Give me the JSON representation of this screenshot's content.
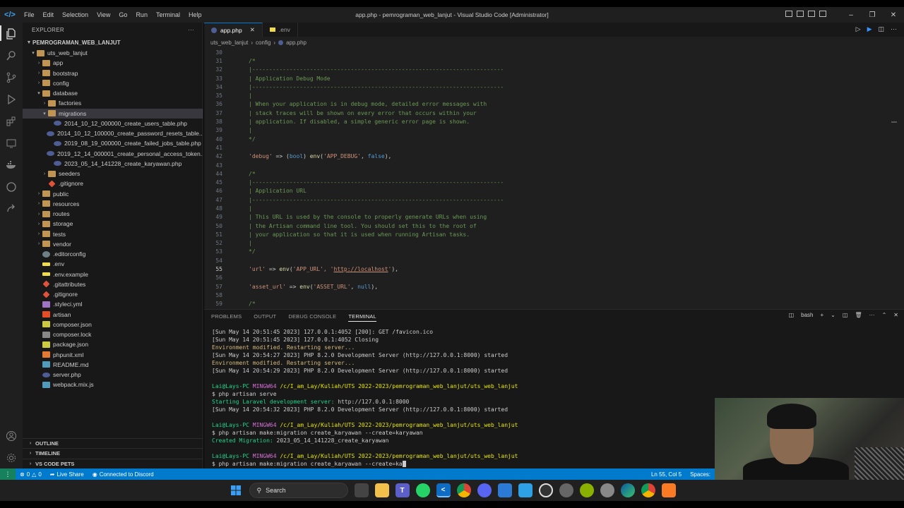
{
  "window": {
    "title": "app.php - pemrograman_web_lanjut - Visual Studio Code [Administrator]",
    "menu": [
      "File",
      "Edit",
      "Selection",
      "View",
      "Go",
      "Run",
      "Terminal",
      "Help"
    ]
  },
  "sidebar": {
    "header": "EXPLORER",
    "root": "PEMROGRAMAN_WEB_LANJUT",
    "tree": [
      {
        "label": "uts_web_lanjut",
        "indent": 0,
        "type": "folder",
        "open": true
      },
      {
        "label": "app",
        "indent": 1,
        "type": "folder"
      },
      {
        "label": "bootstrap",
        "indent": 1,
        "type": "folder"
      },
      {
        "label": "config",
        "indent": 1,
        "type": "folder"
      },
      {
        "label": "database",
        "indent": 1,
        "type": "folder",
        "open": true
      },
      {
        "label": "factories",
        "indent": 2,
        "type": "folder"
      },
      {
        "label": "migrations",
        "indent": 2,
        "type": "folder",
        "open": true,
        "selected": true
      },
      {
        "label": "2014_10_12_000000_create_users_table.php",
        "indent": 3,
        "type": "php"
      },
      {
        "label": "2014_10_12_100000_create_password_resets_table....",
        "indent": 3,
        "type": "php"
      },
      {
        "label": "2019_08_19_000000_create_failed_jobs_table.php",
        "indent": 3,
        "type": "php"
      },
      {
        "label": "2019_12_14_000001_create_personal_access_token...",
        "indent": 3,
        "type": "php"
      },
      {
        "label": "2023_05_14_141228_create_karyawan.php",
        "indent": 3,
        "type": "php"
      },
      {
        "label": "seeders",
        "indent": 2,
        "type": "folder"
      },
      {
        "label": ".gitignore",
        "indent": 2,
        "type": "git"
      },
      {
        "label": "public",
        "indent": 1,
        "type": "folder"
      },
      {
        "label": "resources",
        "indent": 1,
        "type": "folder"
      },
      {
        "label": "routes",
        "indent": 1,
        "type": "folder"
      },
      {
        "label": "storage",
        "indent": 1,
        "type": "folder"
      },
      {
        "label": "tests",
        "indent": 1,
        "type": "folder"
      },
      {
        "label": "vendor",
        "indent": 1,
        "type": "folder"
      },
      {
        "label": ".editorconfig",
        "indent": 1,
        "type": "gear"
      },
      {
        "label": ".env",
        "indent": 1,
        "type": "env"
      },
      {
        "label": ".env.example",
        "indent": 1,
        "type": "env"
      },
      {
        "label": ".gitattributes",
        "indent": 1,
        "type": "git"
      },
      {
        "label": ".gitignore",
        "indent": 1,
        "type": "git"
      },
      {
        "label": ".styleci.yml",
        "indent": 1,
        "type": "yml"
      },
      {
        "label": "artisan",
        "indent": 1,
        "type": "red"
      },
      {
        "label": "composer.json",
        "indent": 1,
        "type": "json"
      },
      {
        "label": "composer.lock",
        "indent": 1,
        "type": "txt"
      },
      {
        "label": "package.json",
        "indent": 1,
        "type": "json"
      },
      {
        "label": "phpunit.xml",
        "indent": 1,
        "type": "xml"
      },
      {
        "label": "README.md",
        "indent": 1,
        "type": "md"
      },
      {
        "label": "server.php",
        "indent": 1,
        "type": "php"
      },
      {
        "label": "webpack.mix.js",
        "indent": 1,
        "type": "js"
      }
    ],
    "sections": [
      "OUTLINE",
      "TIMELINE",
      "VS CODE PETS"
    ]
  },
  "editor": {
    "tabs": [
      {
        "label": "app.php",
        "active": true
      },
      {
        "label": ".env",
        "active": false
      }
    ],
    "breadcrumb": [
      "uts_web_lanjut",
      "config",
      "app.php"
    ],
    "current_line": 55,
    "lines": [
      {
        "n": "30",
        "segs": [
          {
            "t": "",
            "c": ""
          }
        ]
      },
      {
        "n": "31",
        "segs": [
          {
            "t": "/*",
            "c": "cmt"
          }
        ]
      },
      {
        "n": "32",
        "segs": [
          {
            "t": "|--------------------------------------------------------------------------",
            "c": "cmt"
          }
        ]
      },
      {
        "n": "33",
        "segs": [
          {
            "t": "| Application Debug Mode",
            "c": "cmt"
          }
        ]
      },
      {
        "n": "34",
        "segs": [
          {
            "t": "|--------------------------------------------------------------------------",
            "c": "cmt"
          }
        ]
      },
      {
        "n": "35",
        "segs": [
          {
            "t": "|",
            "c": "cmt"
          }
        ]
      },
      {
        "n": "36",
        "segs": [
          {
            "t": "| When your application is in debug mode, detailed error messages with",
            "c": "cmt"
          }
        ]
      },
      {
        "n": "37",
        "segs": [
          {
            "t": "| stack traces will be shown on every error that occurs within your",
            "c": "cmt"
          }
        ]
      },
      {
        "n": "38",
        "segs": [
          {
            "t": "| application. If disabled, a simple generic error page is shown.",
            "c": "cmt"
          }
        ]
      },
      {
        "n": "39",
        "segs": [
          {
            "t": "|",
            "c": "cmt"
          }
        ]
      },
      {
        "n": "40",
        "segs": [
          {
            "t": "*/",
            "c": "cmt"
          }
        ]
      },
      {
        "n": "41",
        "segs": [
          {
            "t": "",
            "c": ""
          }
        ]
      },
      {
        "n": "42",
        "segs": [
          {
            "t": "'debug'",
            "c": "str"
          },
          {
            "t": " => (",
            "c": ""
          },
          {
            "t": "bool",
            "c": "kw"
          },
          {
            "t": ") ",
            "c": ""
          },
          {
            "t": "env",
            "c": "fn"
          },
          {
            "t": "(",
            "c": ""
          },
          {
            "t": "'APP_DEBUG'",
            "c": "str"
          },
          {
            "t": ", ",
            "c": ""
          },
          {
            "t": "false",
            "c": "kw"
          },
          {
            "t": "),",
            "c": ""
          }
        ]
      },
      {
        "n": "43",
        "segs": [
          {
            "t": "",
            "c": ""
          }
        ]
      },
      {
        "n": "44",
        "segs": [
          {
            "t": "/*",
            "c": "cmt"
          }
        ]
      },
      {
        "n": "45",
        "segs": [
          {
            "t": "|--------------------------------------------------------------------------",
            "c": "cmt"
          }
        ]
      },
      {
        "n": "46",
        "segs": [
          {
            "t": "| Application URL",
            "c": "cmt"
          }
        ]
      },
      {
        "n": "47",
        "segs": [
          {
            "t": "|--------------------------------------------------------------------------",
            "c": "cmt"
          }
        ]
      },
      {
        "n": "48",
        "segs": [
          {
            "t": "|",
            "c": "cmt"
          }
        ]
      },
      {
        "n": "49",
        "segs": [
          {
            "t": "| This URL is used by the console to properly generate URLs when using",
            "c": "cmt"
          }
        ]
      },
      {
        "n": "50",
        "segs": [
          {
            "t": "| the Artisan command line tool. You should set this to the root of",
            "c": "cmt"
          }
        ]
      },
      {
        "n": "51",
        "segs": [
          {
            "t": "| your application so that it is used when running Artisan tasks.",
            "c": "cmt"
          }
        ]
      },
      {
        "n": "52",
        "segs": [
          {
            "t": "|",
            "c": "cmt"
          }
        ]
      },
      {
        "n": "53",
        "segs": [
          {
            "t": "*/",
            "c": "cmt"
          }
        ]
      },
      {
        "n": "54",
        "segs": [
          {
            "t": "",
            "c": ""
          }
        ]
      },
      {
        "n": "55",
        "segs": [
          {
            "t": "'url'",
            "c": "str"
          },
          {
            "t": " => ",
            "c": ""
          },
          {
            "t": "env",
            "c": "fn"
          },
          {
            "t": "(",
            "c": ""
          },
          {
            "t": "'APP_URL'",
            "c": "str"
          },
          {
            "t": ", '",
            "c": "str"
          },
          {
            "t": "http://localhost",
            "c": "url"
          },
          {
            "t": "'",
            "c": "str"
          },
          {
            "t": "),",
            "c": ""
          }
        ]
      },
      {
        "n": "56",
        "segs": [
          {
            "t": "",
            "c": ""
          }
        ]
      },
      {
        "n": "57",
        "segs": [
          {
            "t": "'asset_url'",
            "c": "str"
          },
          {
            "t": " => ",
            "c": ""
          },
          {
            "t": "env",
            "c": "fn"
          },
          {
            "t": "(",
            "c": ""
          },
          {
            "t": "'ASSET_URL'",
            "c": "str"
          },
          {
            "t": ", ",
            "c": ""
          },
          {
            "t": "null",
            "c": "kw"
          },
          {
            "t": "),",
            "c": ""
          }
        ]
      },
      {
        "n": "58",
        "segs": [
          {
            "t": "",
            "c": ""
          }
        ]
      },
      {
        "n": "59",
        "segs": [
          {
            "t": "/*",
            "c": "cmt"
          }
        ]
      }
    ]
  },
  "panel": {
    "tabs": [
      "PROBLEMS",
      "OUTPUT",
      "DEBUG CONSOLE",
      "TERMINAL"
    ],
    "active_tab": "TERMINAL",
    "shell": "bash",
    "terminal_lines": [
      [
        {
          "t": "[Sun May 14 20:51:45 2023] 127.0.0.1:4052 [200]: GET /favicon.ico",
          "c": ""
        }
      ],
      [
        {
          "t": "[Sun May 14 20:51:45 2023] 127.0.0.1:4052 Closing",
          "c": ""
        }
      ],
      [
        {
          "t": "Environment modified. Restarting server...",
          "c": "t-yel"
        }
      ],
      [
        {
          "t": "[Sun May 14 20:54:27 2023] PHP 8.2.0 Development Server (http://127.0.0.1:8000) started",
          "c": ""
        }
      ],
      [
        {
          "t": "Environment modified. Restarting server...",
          "c": "t-yel"
        }
      ],
      [
        {
          "t": "[Sun May 14 20:54:29 2023] PHP 8.2.0 Development Server (http://127.0.0.1:8000) started",
          "c": ""
        }
      ],
      [
        {
          "t": "",
          "c": ""
        }
      ],
      [
        {
          "t": "Lai@Lays-PC ",
          "c": "t-usr"
        },
        {
          "t": "MINGW64 ",
          "c": "t-mag"
        },
        {
          "t": "/c/I_am_Lay/Kuliah/UTS 2022-2023/pemrograman_web_lanjut/uts_web_lanjut",
          "c": "t-path"
        }
      ],
      [
        {
          "t": "$ php artisan serve",
          "c": ""
        }
      ],
      [
        {
          "t": "Starting Laravel development server: ",
          "c": "t-grn"
        },
        {
          "t": "http://127.0.0.1:8000",
          "c": ""
        }
      ],
      [
        {
          "t": "[Sun May 14 20:54:32 2023] PHP 8.2.0 Development Server (http://127.0.0.1:8000) started",
          "c": ""
        }
      ],
      [
        {
          "t": "",
          "c": ""
        }
      ],
      [
        {
          "t": "Lai@Lays-PC ",
          "c": "t-usr"
        },
        {
          "t": "MINGW64 ",
          "c": "t-mag"
        },
        {
          "t": "/c/I_am_Lay/Kuliah/UTS 2022-2023/pemrograman_web_lanjut/uts_web_lanjut",
          "c": "t-path"
        }
      ],
      [
        {
          "t": "$ php artisan make:migration create_karyawan --create=karyawan",
          "c": ""
        }
      ],
      [
        {
          "t": "Created Migration: ",
          "c": "t-grn"
        },
        {
          "t": "2023_05_14_141228_create_karyawan",
          "c": ""
        }
      ],
      [
        {
          "t": "",
          "c": ""
        }
      ],
      [
        {
          "t": "Lai@Lays-PC ",
          "c": "t-usr"
        },
        {
          "t": "MINGW64 ",
          "c": "t-mag"
        },
        {
          "t": "/c/I_am_Lay/Kuliah/UTS 2022-2023/pemrograman_web_lanjut/uts_web_lanjut",
          "c": "t-path"
        }
      ],
      [
        {
          "t": "$ php artisan make:migration create_karyawan --create=ka",
          "c": ""
        }
      ]
    ]
  },
  "statusbar": {
    "errors": "0",
    "warnings": "0",
    "live_share": "Live Share",
    "discord": "Connected to Discord",
    "position": "Ln 55, Col 5",
    "spaces": "Spaces:"
  },
  "taskbar": {
    "search_label": "Search",
    "icons": [
      "windows-start-icon",
      "task-view-icon",
      "file-explorer-icon",
      "teams-icon",
      "whatsapp-icon",
      "vscode-icon",
      "chrome-icon",
      "discord-icon",
      "photos-icon",
      "notepad-icon",
      "obs-icon",
      "settings-icon",
      "android-icon",
      "chrome-alt-icon",
      "edge-icon",
      "chrome-profile-icon",
      "xampp-icon"
    ]
  },
  "colors": {
    "accent": "#007acc",
    "remote": "#16825d",
    "comment": "#6a9955",
    "string": "#ce9178",
    "keyword": "#569cd6"
  }
}
